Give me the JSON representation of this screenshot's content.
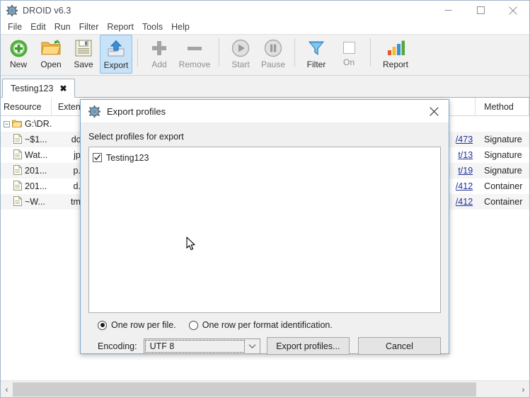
{
  "window": {
    "title": "DROID v6.3",
    "icon": "gear-icon",
    "minimize": "minimize-icon",
    "maximize": "maximize-icon",
    "close": "close-icon"
  },
  "menubar": {
    "items": [
      {
        "label": "File"
      },
      {
        "label": "Edit"
      },
      {
        "label": "Run"
      },
      {
        "label": "Filter"
      },
      {
        "label": "Report"
      },
      {
        "label": "Tools"
      },
      {
        "label": "Help"
      }
    ]
  },
  "toolbar": {
    "buttons": [
      {
        "label": "New",
        "icon": "plus-circle-green-icon",
        "state": "enabled"
      },
      {
        "label": "Open",
        "icon": "folder-open-icon",
        "state": "enabled"
      },
      {
        "label": "Save",
        "icon": "floppy-disk-icon",
        "state": "enabled"
      },
      {
        "label": "Export",
        "icon": "export-up-arrow-icon",
        "state": "selected"
      },
      {
        "label": "Add",
        "icon": "plus-icon",
        "state": "disabled"
      },
      {
        "label": "Remove",
        "icon": "minus-icon",
        "state": "disabled"
      },
      {
        "label": "Start",
        "icon": "play-icon",
        "state": "disabled"
      },
      {
        "label": "Pause",
        "icon": "pause-icon",
        "state": "disabled"
      },
      {
        "label": "Filter",
        "icon": "funnel-icon",
        "state": "enabled"
      },
      {
        "label": "On",
        "icon": "checkbox-unchecked-icon",
        "state": "disabled"
      },
      {
        "label": "Report",
        "icon": "bar-chart-icon",
        "state": "enabled"
      }
    ]
  },
  "tabs": [
    {
      "label": "Testing123",
      "close": "✖",
      "active": true
    }
  ],
  "table": {
    "columns": [
      {
        "key": "resource",
        "label": "Resource"
      },
      {
        "key": "extension",
        "label": "Exten..."
      },
      {
        "key": "method",
        "label": "Method"
      }
    ],
    "rows": [
      {
        "resource": "G:\\DR...",
        "icon": "folder-icon",
        "toggle": "−",
        "type": "folder",
        "extension": "",
        "link": "",
        "method": ""
      },
      {
        "resource": "~$1...",
        "icon": "file-icon",
        "type": "file",
        "extension": "doc",
        "link": "/473",
        "method": "Signature"
      },
      {
        "resource": "Wat...",
        "icon": "file-icon",
        "type": "file",
        "extension": "jpg",
        "link": "t/13",
        "method": "Signature"
      },
      {
        "resource": "201...",
        "icon": "file-icon",
        "type": "file",
        "extension": "p...",
        "link": "t/19",
        "method": "Signature"
      },
      {
        "resource": "201...",
        "icon": "file-icon",
        "type": "file",
        "extension": "d...",
        "link": "/412",
        "method": "Container"
      },
      {
        "resource": "~W...",
        "icon": "file-icon",
        "type": "file",
        "extension": "tmp",
        "link": "/412",
        "method": "Container"
      }
    ]
  },
  "scrollbar": {
    "left_arrow": "‹",
    "right_arrow": "›"
  },
  "dialog": {
    "title": "Export profiles",
    "icon": "gear-icon",
    "close": "close-icon",
    "select_label": "Select profiles for export",
    "profiles": [
      {
        "label": "Testing123",
        "checked": true,
        "check_glyph": "✓"
      }
    ],
    "radios": [
      {
        "label": "One row per file.",
        "selected": true
      },
      {
        "label": "One row per format identification.",
        "selected": false
      }
    ],
    "encoding_label": "Encoding:",
    "encoding_value": "UTF 8",
    "encoding_arrow": "⌄",
    "export_button": "Export profiles...",
    "cancel_button": "Cancel"
  },
  "colors": {
    "accent": "#c8e2f7",
    "link": "#21319b",
    "dialog_border": "#7ba7cf",
    "toolbar_bg": "#f1f1f1"
  }
}
